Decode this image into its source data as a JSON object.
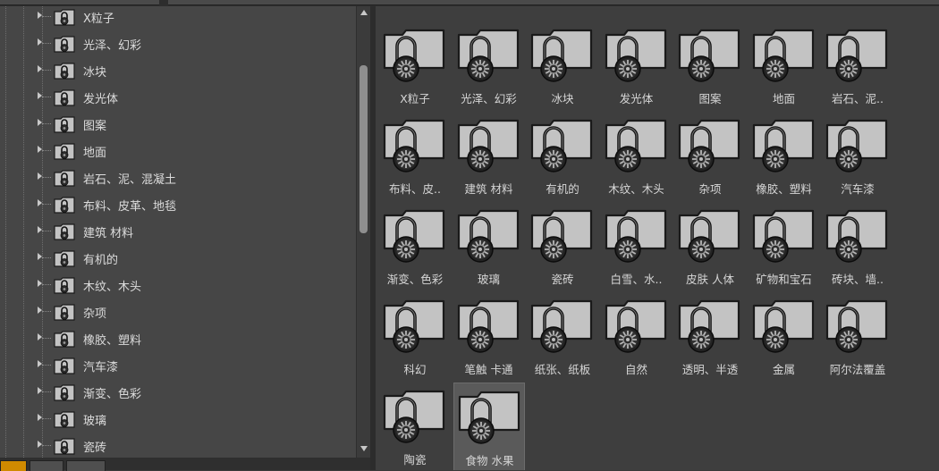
{
  "tree_items": [
    "X粒子",
    "光泽、幻彩",
    "冰块",
    "发光体",
    "图案",
    "地面",
    "岩石、泥、混凝土",
    "布料、皮革、地毯",
    "建筑 材料",
    "有机的",
    "木纹、木头",
    "杂项",
    "橡胶、塑料",
    "汽车漆",
    "渐变、色彩",
    "玻璃",
    "瓷砖"
  ],
  "grid_items": [
    "X粒子",
    "光泽、幻彩",
    "冰块",
    "发光体",
    "图案",
    "地面",
    "岩石、泥..",
    "布料、皮..",
    "建筑 材料",
    "有机的",
    "木纹、木头",
    "杂项",
    "橡胶、塑料",
    "汽车漆",
    "渐变、色彩",
    "玻璃",
    "瓷砖",
    "白雪、水..",
    "皮肤 人体",
    "矿物和宝石",
    "砖块、墙..",
    "科幻",
    "笔触 卡通",
    "纸张、纸板",
    "自然",
    "透明、半透",
    "金属",
    "阿尔法覆盖",
    "陶瓷",
    "食物 水果"
  ],
  "selected_grid_index": 29,
  "icons": {
    "folder": "locked-folder-icon",
    "lock": "padlock-icon",
    "dial": "combination-dial-icon"
  },
  "colors": {
    "folder_fill": "#c3c3c3",
    "folder_outline": "#1a1a1a",
    "accent_tab": "#d08a00"
  }
}
